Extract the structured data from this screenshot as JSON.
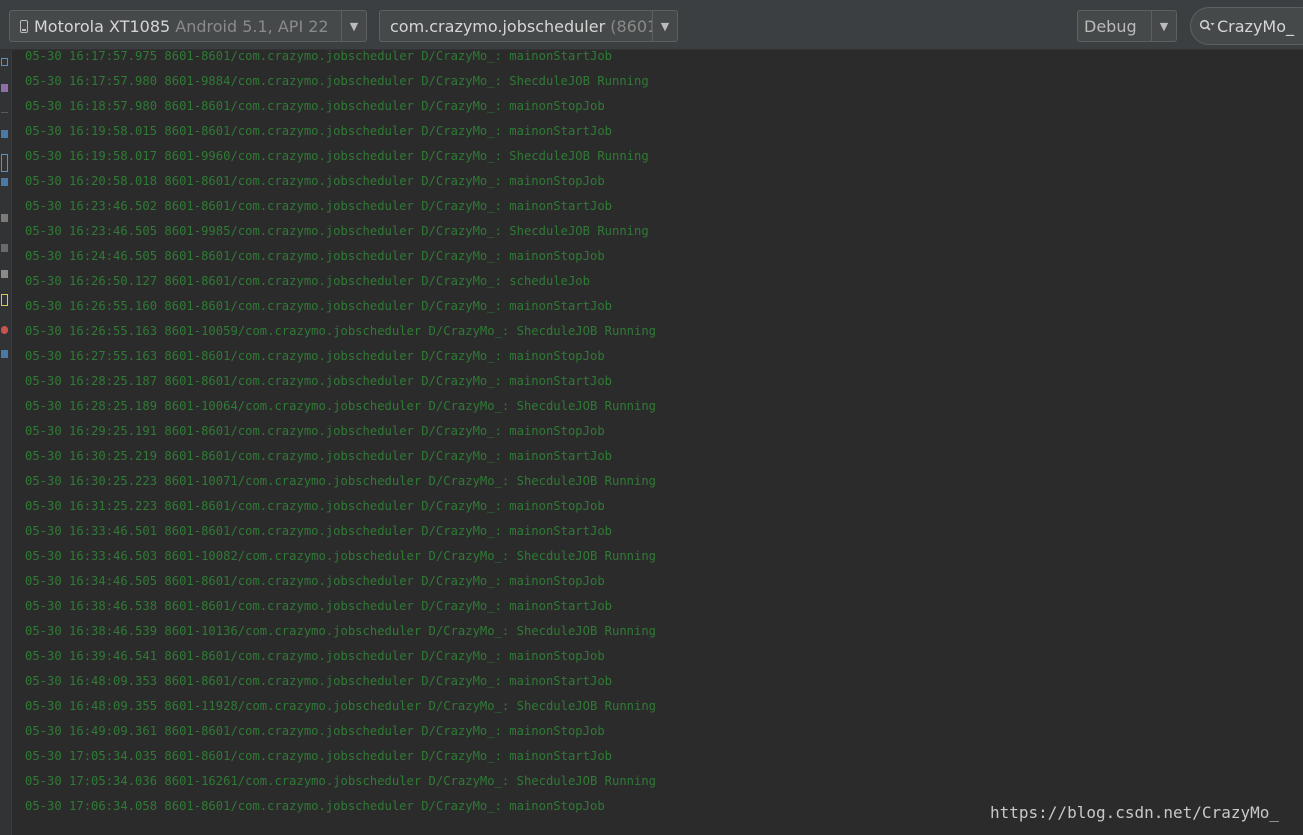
{
  "toolbar": {
    "device": {
      "name": "Motorola XT1085",
      "detail": "Android 5.1, API 22",
      "icon": "phone-icon"
    },
    "process": {
      "name": "com.crazymo.jobscheduler",
      "pid": "(8601)"
    },
    "log_level": "Debug",
    "search": {
      "value": "CrazyMo_",
      "icon": "search-icon"
    }
  },
  "log": {
    "color": "#2f7a35",
    "lines": [
      "05-30 16:17:57.975 8601-8601/com.crazymo.jobscheduler D/CrazyMo_: mainonStartJob",
      "05-30 16:17:57.980 8601-9884/com.crazymo.jobscheduler D/CrazyMo_: ShecduleJOB Running",
      "05-30 16:18:57.980 8601-8601/com.crazymo.jobscheduler D/CrazyMo_: mainonStopJob",
      "05-30 16:19:58.015 8601-8601/com.crazymo.jobscheduler D/CrazyMo_: mainonStartJob",
      "05-30 16:19:58.017 8601-9960/com.crazymo.jobscheduler D/CrazyMo_: ShecduleJOB Running",
      "05-30 16:20:58.018 8601-8601/com.crazymo.jobscheduler D/CrazyMo_: mainonStopJob",
      "05-30 16:23:46.502 8601-8601/com.crazymo.jobscheduler D/CrazyMo_: mainonStartJob",
      "05-30 16:23:46.505 8601-9985/com.crazymo.jobscheduler D/CrazyMo_: ShecduleJOB Running",
      "05-30 16:24:46.505 8601-8601/com.crazymo.jobscheduler D/CrazyMo_: mainonStopJob",
      "05-30 16:26:50.127 8601-8601/com.crazymo.jobscheduler D/CrazyMo_: scheduleJob",
      "05-30 16:26:55.160 8601-8601/com.crazymo.jobscheduler D/CrazyMo_: mainonStartJob",
      "05-30 16:26:55.163 8601-10059/com.crazymo.jobscheduler D/CrazyMo_: ShecduleJOB Running",
      "05-30 16:27:55.163 8601-8601/com.crazymo.jobscheduler D/CrazyMo_: mainonStopJob",
      "05-30 16:28:25.187 8601-8601/com.crazymo.jobscheduler D/CrazyMo_: mainonStartJob",
      "05-30 16:28:25.189 8601-10064/com.crazymo.jobscheduler D/CrazyMo_: ShecduleJOB Running",
      "05-30 16:29:25.191 8601-8601/com.crazymo.jobscheduler D/CrazyMo_: mainonStopJob",
      "05-30 16:30:25.219 8601-8601/com.crazymo.jobscheduler D/CrazyMo_: mainonStartJob",
      "05-30 16:30:25.223 8601-10071/com.crazymo.jobscheduler D/CrazyMo_: ShecduleJOB Running",
      "05-30 16:31:25.223 8601-8601/com.crazymo.jobscheduler D/CrazyMo_: mainonStopJob",
      "05-30 16:33:46.501 8601-8601/com.crazymo.jobscheduler D/CrazyMo_: mainonStartJob",
      "05-30 16:33:46.503 8601-10082/com.crazymo.jobscheduler D/CrazyMo_: ShecduleJOB Running",
      "05-30 16:34:46.505 8601-8601/com.crazymo.jobscheduler D/CrazyMo_: mainonStopJob",
      "05-30 16:38:46.538 8601-8601/com.crazymo.jobscheduler D/CrazyMo_: mainonStartJob",
      "05-30 16:38:46.539 8601-10136/com.crazymo.jobscheduler D/CrazyMo_: ShecduleJOB Running",
      "05-30 16:39:46.541 8601-8601/com.crazymo.jobscheduler D/CrazyMo_: mainonStopJob",
      "05-30 16:48:09.353 8601-8601/com.crazymo.jobscheduler D/CrazyMo_: mainonStartJob",
      "05-30 16:48:09.355 8601-11928/com.crazymo.jobscheduler D/CrazyMo_: ShecduleJOB Running",
      "05-30 16:49:09.361 8601-8601/com.crazymo.jobscheduler D/CrazyMo_: mainonStopJob",
      "05-30 17:05:34.035 8601-8601/com.crazymo.jobscheduler D/CrazyMo_: mainonStartJob",
      "05-30 17:05:34.036 8601-16261/com.crazymo.jobscheduler D/CrazyMo_: ShecduleJOB Running",
      "05-30 17:06:34.058 8601-8601/com.crazymo.jobscheduler D/CrazyMo_: mainonStopJob"
    ]
  },
  "watermark": "https://blog.csdn.net/CrazyMo_"
}
